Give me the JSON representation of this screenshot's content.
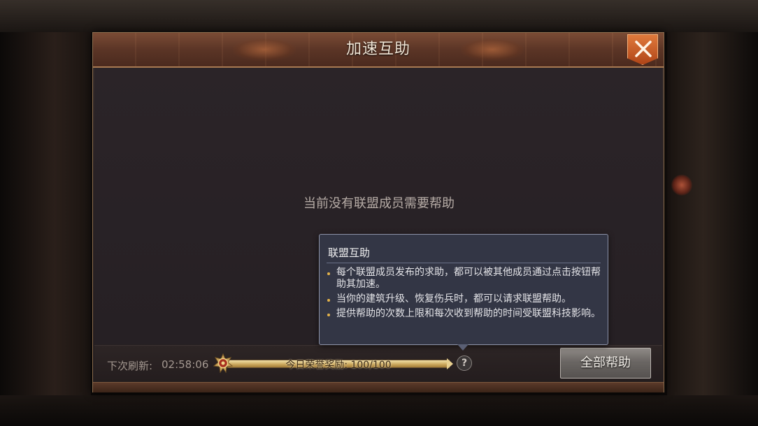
{
  "dialog": {
    "title": "加速互助",
    "close_icon": "close-x-icon",
    "empty_message": "当前没有联盟成员需要帮助"
  },
  "footer": {
    "refresh_label": "下次刷新:",
    "refresh_time": "02:58:06",
    "medal_icon": "honor-medal-icon",
    "progress_text": "今日荣誉奖励: 100/100",
    "progress_fraction": 1.0,
    "help_icon": "?",
    "help_all_label": "全部帮助"
  },
  "tooltip": {
    "title": "联盟互助",
    "items": [
      "每个联盟成员发布的求助，都可以被其他成员通过点击按钮帮助其加速。",
      "当你的建筑升级、恢复伤兵时，都可以请求联盟帮助。",
      "提供帮助的次数上限和每次收到帮助的时间受联盟科技影响。"
    ]
  },
  "colors": {
    "header": "#5b3526",
    "accent_close": "#d0622c",
    "progress_gold": "#e7cf8f",
    "tooltip_bg": "#343746"
  }
}
